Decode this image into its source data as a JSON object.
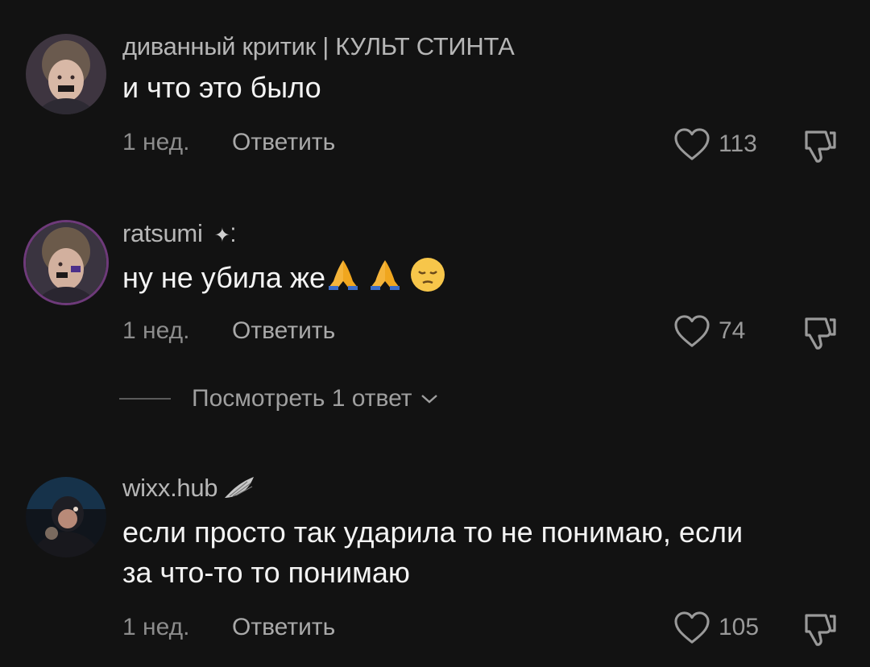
{
  "comments": [
    {
      "author": "диванный критик | КУЛЬТ СТИНТА",
      "text": "и что это было",
      "time": "1 нед.",
      "reply": "Ответить",
      "likes": "113"
    },
    {
      "author": "ratsumi",
      "author_suffix": "✦⁚",
      "text": "ну не убила же",
      "emojis": [
        "pray-emoji",
        "pray-emoji",
        "pensive-emoji"
      ],
      "time": "1 нед.",
      "reply": "Ответить",
      "likes": "74"
    },
    {
      "author": "wixx.hub",
      "text_line1": "если просто так ударила то не понимаю, если",
      "text_line2": "за что-то то понимаю",
      "time": "1 нед.",
      "reply": "Ответить",
      "likes": "105"
    }
  ],
  "view_replies": "Посмотреть 1 ответ",
  "colors": {
    "background": "#121212",
    "text": "#f4f4f4",
    "secondary": "#8c8c8c"
  }
}
